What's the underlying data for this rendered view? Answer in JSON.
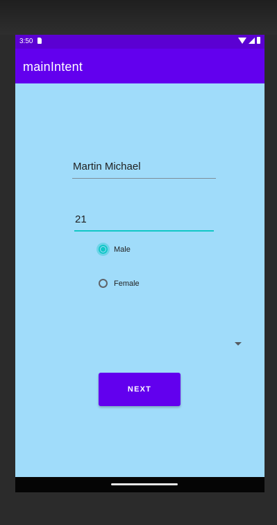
{
  "status_bar": {
    "time": "3:50"
  },
  "app_bar": {
    "title": "mainIntent"
  },
  "form": {
    "name_value": "Martin Michael",
    "age_value": "21",
    "gender_options": [
      {
        "label": "Male",
        "checked": true
      },
      {
        "label": "Female",
        "checked": false
      }
    ],
    "next_label": "NEXT"
  },
  "colors": {
    "primary": "#6200ee",
    "status_bar": "#5b00d2",
    "accent": "#11c7c6",
    "background": "#a0dcfa"
  },
  "icons": {
    "status": [
      "sd-card-icon",
      "wifi-icon",
      "signal-icon",
      "battery-icon"
    ],
    "spinner": "dropdown-arrow-icon"
  }
}
